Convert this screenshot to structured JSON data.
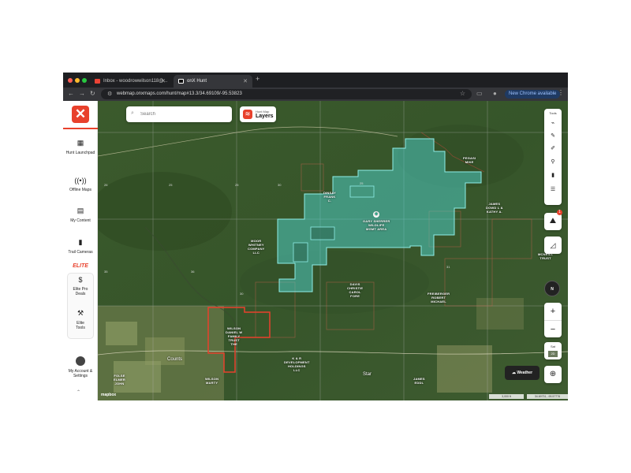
{
  "browser": {
    "tabs": [
      {
        "title": "Inbox - woodrowwilson118@...",
        "active": false,
        "favicon": "gmail-icon"
      },
      {
        "title": "onX Hunt",
        "active": true,
        "favicon": "onx-icon"
      }
    ],
    "new_tab": "+",
    "url": "webmap.onxmaps.com/hunt/map#13.3/34.69109/-95.53823",
    "new_chrome_label": "New Chrome available"
  },
  "sidebar": {
    "logo": "✕",
    "items": [
      {
        "label": "Hunt Launchpad",
        "icon": "grid-icon"
      },
      {
        "label": "Offline Maps",
        "icon": "broadcast-icon"
      },
      {
        "label": "My Content",
        "icon": "folder-icon"
      },
      {
        "label": "Trail Cameras",
        "icon": "camera-icon"
      }
    ],
    "elite_label": "ELITE",
    "elite_items": [
      {
        "label": "Elite Pro Deals",
        "icon": "dollar-icon"
      },
      {
        "label": "Elite Tools",
        "icon": "tools-icon"
      }
    ],
    "account_label": "My Account & Settings"
  },
  "search": {
    "placeholder": "Search"
  },
  "layers": {
    "subtitle": "Hunt Map",
    "label": "Layers"
  },
  "tools": {
    "title": "Tools",
    "items": [
      "route-icon",
      "pen-icon",
      "measure-icon",
      "waypoint-icon",
      "share-icon",
      "filter-icon"
    ]
  },
  "map": {
    "wildlife_area": [
      "GARY SHERRER",
      "WILDLIFE",
      "MGMT AREA"
    ],
    "owner_labels": [
      [
        "PEGASI",
        "MIKE"
      ],
      [
        "DINSAY",
        "FRANK",
        "C."
      ],
      [
        "JAMES",
        "DOWD L &",
        "KATHY A."
      ],
      [
        "MOOR",
        "WHITNEY",
        "COMPANY",
        "LLC"
      ],
      [
        "MCNEILL",
        "TRUST"
      ],
      [
        "DAVIS",
        "CHRISTIE",
        "CAROL",
        "FORE"
      ],
      [
        "FREIBERGER",
        "ROBERT",
        "MICHAEL"
      ],
      [
        "WILSON",
        "DANIEL W",
        "FAMILY",
        "TRUST",
        "THE"
      ],
      [
        "K & R",
        "DEVELOPMENT",
        "HOLDINGS",
        "LLC"
      ],
      [
        "FOLSE",
        "ELMER",
        "JOHN"
      ],
      [
        "WILSON",
        "MARTY"
      ],
      [
        "JAMES",
        "EDDL"
      ]
    ],
    "section_numbers": [
      "26",
      "25",
      "30",
      "35",
      "36",
      "31",
      "25",
      "25",
      "30"
    ],
    "towns": [
      "Counts",
      "Star"
    ],
    "attribution": "mapbox",
    "scale": "3,000 ft",
    "coords": "34.69731, -95.57776",
    "colors": {
      "wma_fill": "#4fd6d0",
      "owner_line": "#e8412c",
      "accent": "#e8412c"
    }
  },
  "buttons": {
    "weather": "Weather",
    "zoom_in": "+",
    "zoom_out": "−",
    "sat_label": "Sat",
    "sat_zoom": "2D",
    "compass": "N",
    "badge": "1"
  }
}
